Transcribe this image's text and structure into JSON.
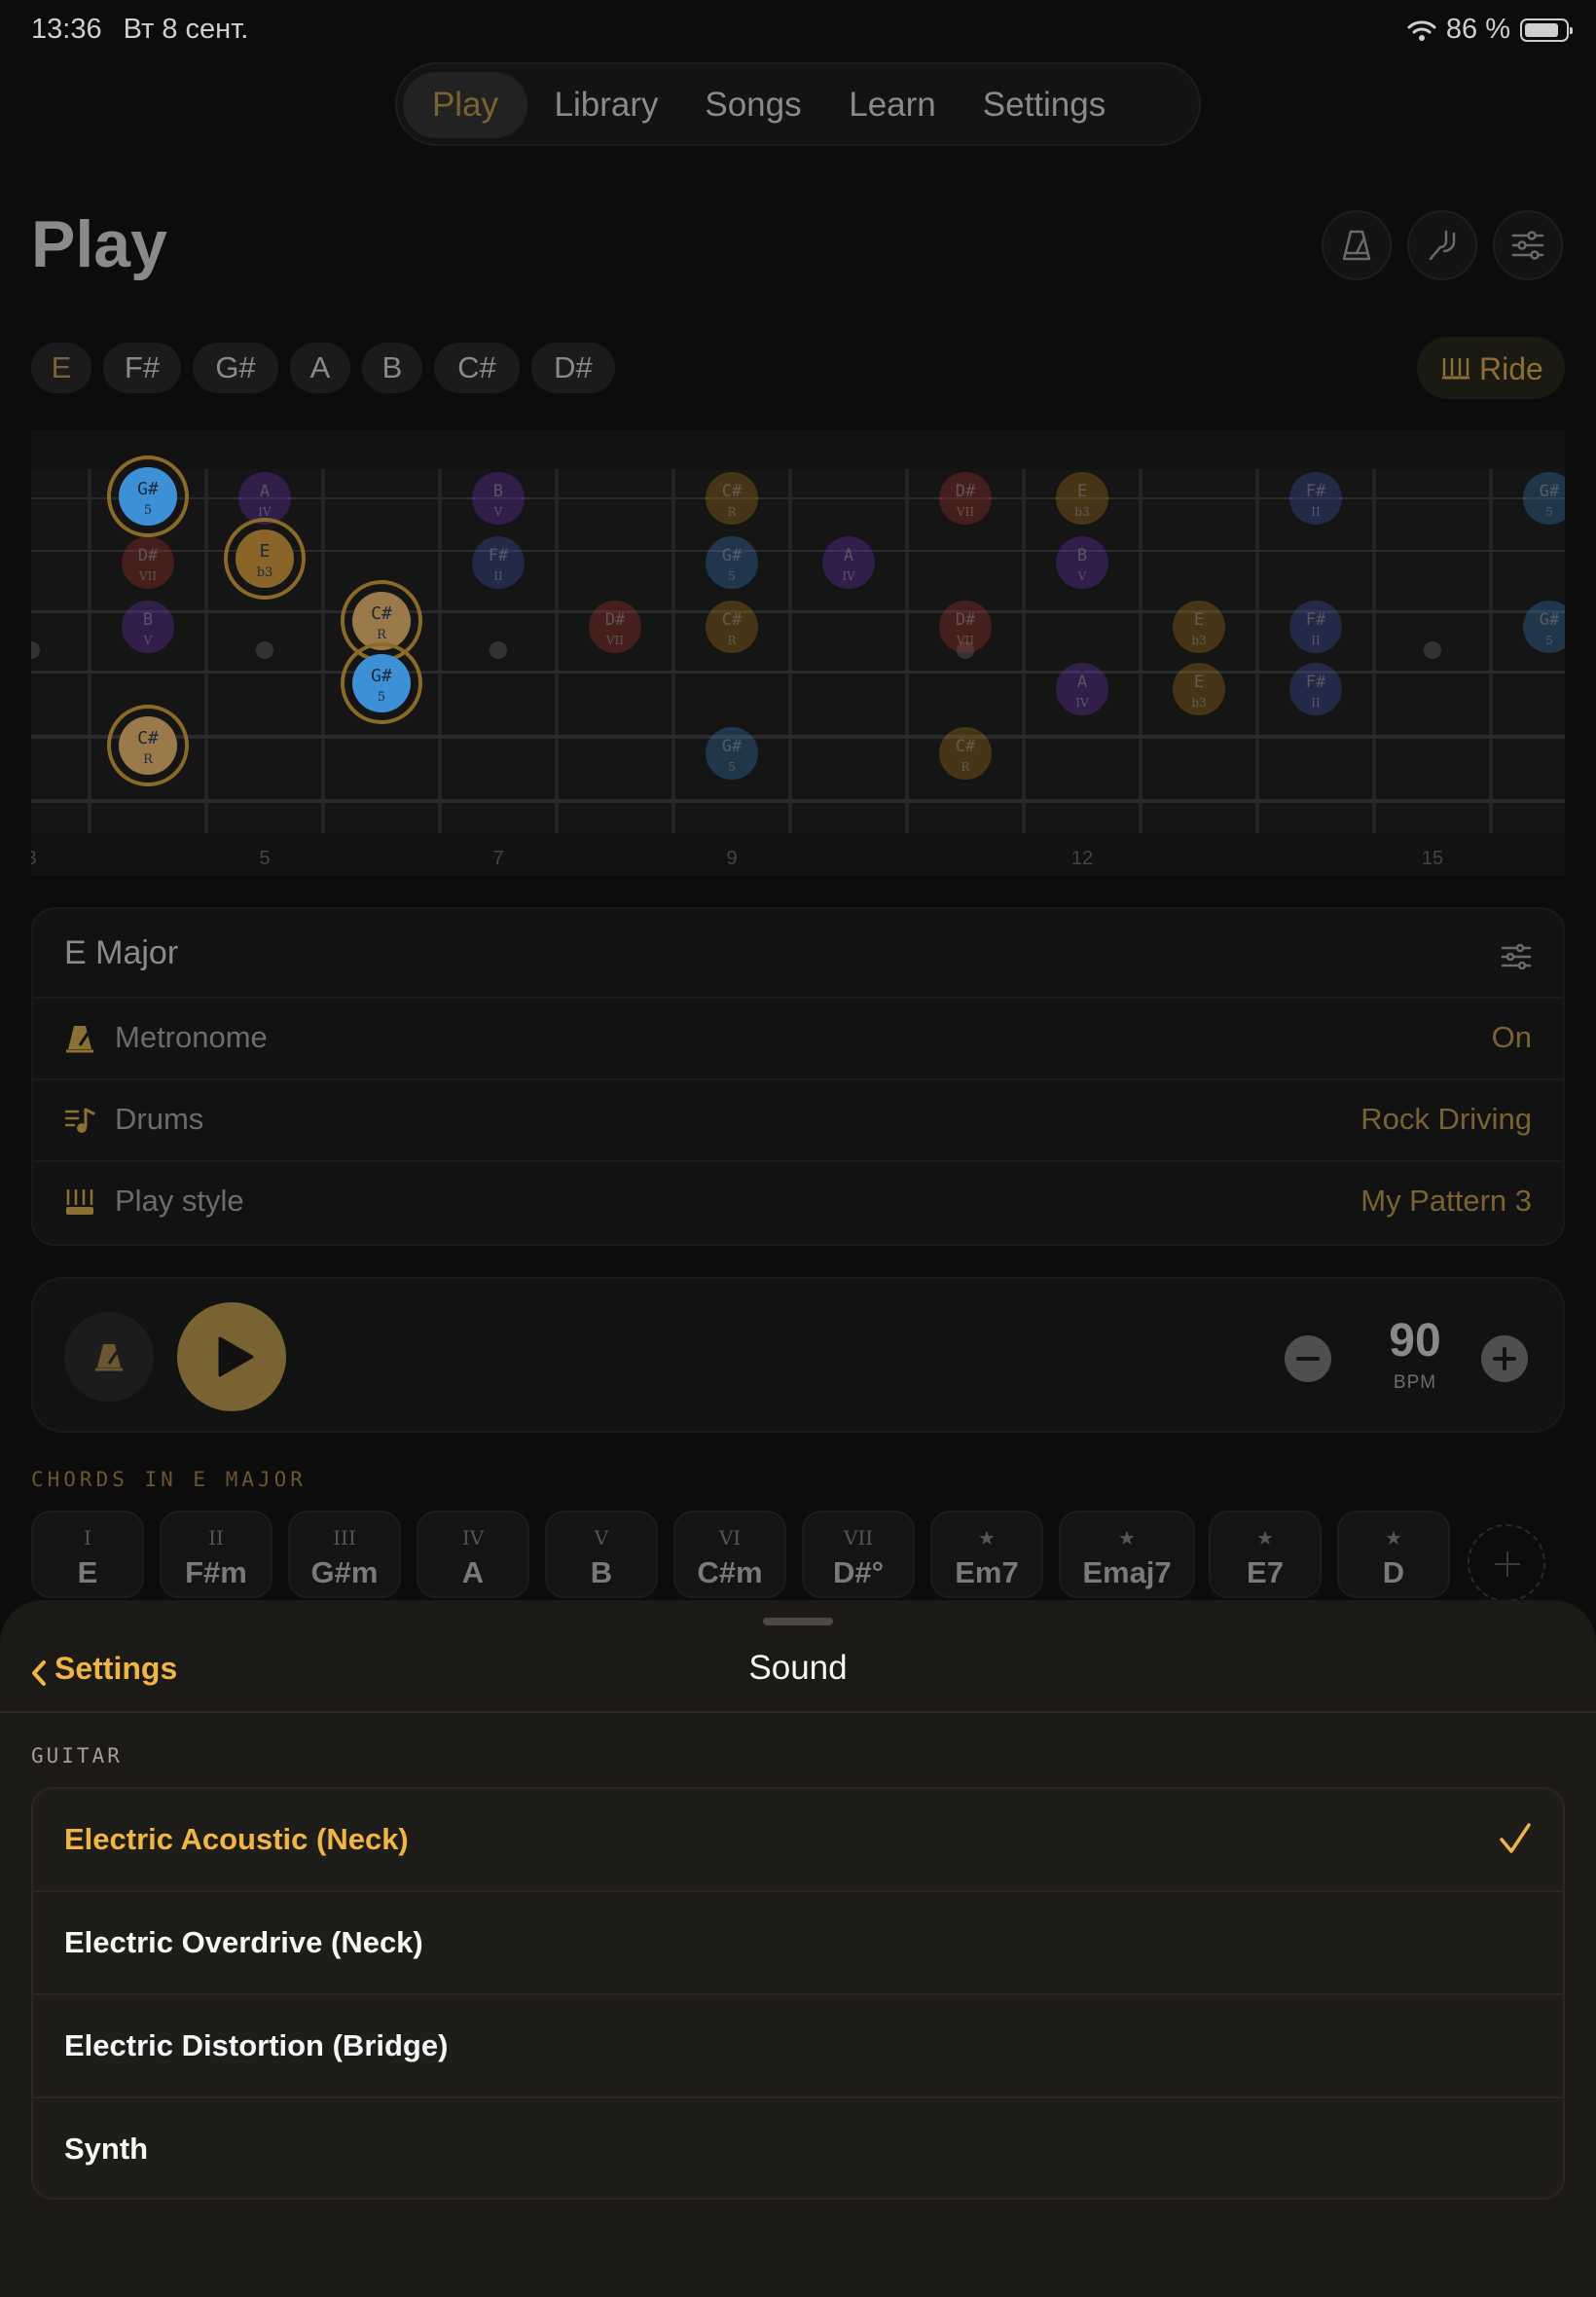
{
  "status": {
    "time": "13:36",
    "date": "Вт 8 сент.",
    "battery": "86 %",
    "battery_level": 0.86
  },
  "nav": {
    "tabs": [
      "Play",
      "Library",
      "Songs",
      "Learn",
      "Settings"
    ],
    "active": "Play"
  },
  "page": {
    "title": "Play"
  },
  "header_icons": [
    "metronome-icon",
    "tuning-fork-icon",
    "sliders-icon"
  ],
  "scale_notes": [
    "E",
    "F#",
    "G#",
    "A",
    "B",
    "C#",
    "D#"
  ],
  "ride_button": {
    "label": "Ride",
    "icon": "strum-pattern-icon"
  },
  "fretboard": {
    "fret_numbers": [
      "3",
      "5",
      "7",
      "9",
      "12",
      "15"
    ],
    "colors": {
      "third": "#3d8fd6",
      "root": "#c8871e",
      "seventh": "#c03a2a",
      "second": "#7c3bd0",
      "fourth": "#4660c8",
      "sixth": "#5a3cc8"
    },
    "highlighted_notes": [
      {
        "note": "G#",
        "degree": "5"
      },
      {
        "note": "E",
        "degree": "b3"
      },
      {
        "note": "C#",
        "degree": "R"
      },
      {
        "note": "G#",
        "degree": "5"
      },
      {
        "note": "C#",
        "degree": "R"
      }
    ],
    "dimmed_notes": [
      {
        "note": "A",
        "degree": "IV"
      },
      {
        "note": "B",
        "degree": "V"
      },
      {
        "note": "C#",
        "degree": "R"
      },
      {
        "note": "D#",
        "degree": "VII"
      },
      {
        "note": "E",
        "degree": "b3"
      },
      {
        "note": "F#",
        "degree": "II"
      },
      {
        "note": "G#",
        "degree": "5"
      },
      {
        "note": "D#",
        "degree": "VII"
      },
      {
        "note": "B",
        "degree": "V"
      },
      {
        "note": "F#",
        "degree": "II"
      },
      {
        "note": "G#",
        "degree": "5"
      },
      {
        "note": "A",
        "degree": "IV"
      },
      {
        "note": "B",
        "degree": "V"
      },
      {
        "note": "C#",
        "degree": "R"
      },
      {
        "note": "D#",
        "degree": "VII"
      },
      {
        "note": "E",
        "degree": "b3"
      },
      {
        "note": "F#",
        "degree": "II"
      },
      {
        "note": "G#",
        "degree": "5"
      },
      {
        "note": "D#",
        "degree": "VII"
      },
      {
        "note": "A",
        "degree": "IV"
      },
      {
        "note": "E",
        "degree": "b3"
      },
      {
        "note": "F#",
        "degree": "II"
      },
      {
        "note": "G#",
        "degree": "5"
      },
      {
        "note": "C#",
        "degree": "R"
      }
    ]
  },
  "scale_card": {
    "title": "E Major",
    "rows": [
      {
        "label": "Metronome",
        "value": "On",
        "icon": "metronome-icon"
      },
      {
        "label": "Drums",
        "value": "Rock Driving",
        "icon": "drums-icon"
      },
      {
        "label": "Play style",
        "value": "My Pattern 3",
        "icon": "strum-pattern-icon"
      }
    ]
  },
  "transport": {
    "bpm": "90",
    "bpm_label": "BPM"
  },
  "chords": {
    "header": "CHORDS IN E MAJOR",
    "items": [
      {
        "degree": "I",
        "name": "E"
      },
      {
        "degree": "II",
        "name": "F#m"
      },
      {
        "degree": "III",
        "name": "G#m"
      },
      {
        "degree": "IV",
        "name": "A"
      },
      {
        "degree": "V",
        "name": "B"
      },
      {
        "degree": "VI",
        "name": "C#m"
      },
      {
        "degree": "VII",
        "name": "D#°"
      },
      {
        "degree": "★",
        "name": "Em7"
      },
      {
        "degree": "★",
        "name": "Emaj7"
      },
      {
        "degree": "★",
        "name": "E7"
      },
      {
        "degree": "★",
        "name": "D"
      }
    ]
  },
  "sheet": {
    "back_label": "Settings",
    "title": "Sound",
    "section": "GUITAR",
    "options": [
      {
        "label": "Electric Acoustic (Neck)",
        "selected": true
      },
      {
        "label": "Electric Overdrive (Neck)",
        "selected": false
      },
      {
        "label": "Electric Distortion (Bridge)",
        "selected": false
      },
      {
        "label": "Synth",
        "selected": false
      }
    ],
    "accent": "#f0b544"
  }
}
